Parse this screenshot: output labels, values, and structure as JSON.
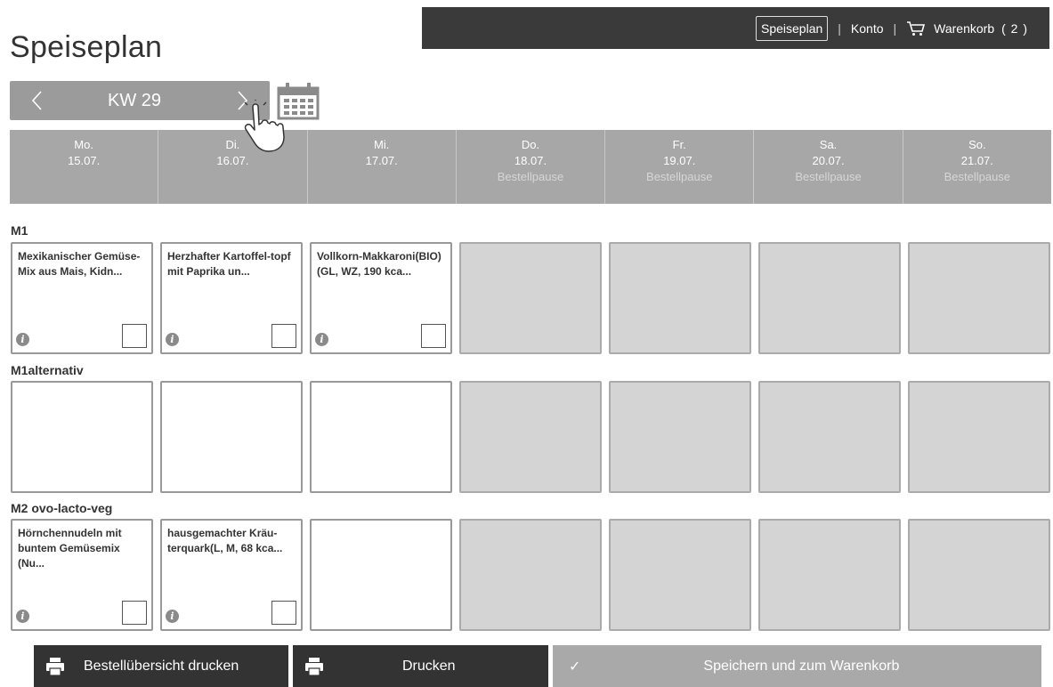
{
  "nav": {
    "speiseplan": "Speiseplan",
    "separator": "|",
    "konto": "Konto",
    "cart_label": "Warenkorb",
    "cart_count": "( 2 )",
    "cart_icon": "cart-icon"
  },
  "page": {
    "title": "Speiseplan"
  },
  "week": {
    "label": "KW 29",
    "prev": "‹",
    "next": "›",
    "calendar_icon": "calendar-icon"
  },
  "days": [
    {
      "name": "Mo.",
      "date": "15.07.",
      "status": ""
    },
    {
      "name": "Di.",
      "date": "16.07.",
      "status": ""
    },
    {
      "name": "Mi.",
      "date": "17.07.",
      "status": ""
    },
    {
      "name": "Do.",
      "date": "18.07.",
      "status": "Bestellpause"
    },
    {
      "name": "Fr.",
      "date": "19.07.",
      "status": "Bestellpause"
    },
    {
      "name": "Sa.",
      "date": "20.07.",
      "status": "Bestellpause"
    },
    {
      "name": "So.",
      "date": "21.07.",
      "status": "Bestellpause"
    }
  ],
  "meals": [
    {
      "label": "M1",
      "dishes": [
        "Mexikanischer Gemüse-Mix aus Mais, Kidn...",
        "Herzhafter Kartoffel-topf mit Paprika un...",
        "Vollkorn-Makkaroni(BIO)(GL, WZ, 190 kca..."
      ]
    },
    {
      "label": "M1alternativ",
      "dishes": [
        "",
        "",
        ""
      ]
    },
    {
      "label": "M2 ovo-lacto-veg",
      "dishes": [
        "Hörnchennudeln mit buntem Gemüsemix (Nu...",
        "hausgemachter Kräu-terquark(L, M, 68 kca...",
        ""
      ]
    }
  ],
  "info_glyph": "i",
  "buttons": {
    "print_overview": "Bestellübersicht drucken",
    "print": "Drucken",
    "save": "Speichern und zum Warenkorb",
    "check_glyph": "✓"
  },
  "colors": {
    "nav_bg": "#3a3a3a",
    "header_bg": "#a7a7a7",
    "disabled_cell": "#d4d4d4",
    "button_dark": "#333333",
    "button_light": "#a9a9a9"
  }
}
